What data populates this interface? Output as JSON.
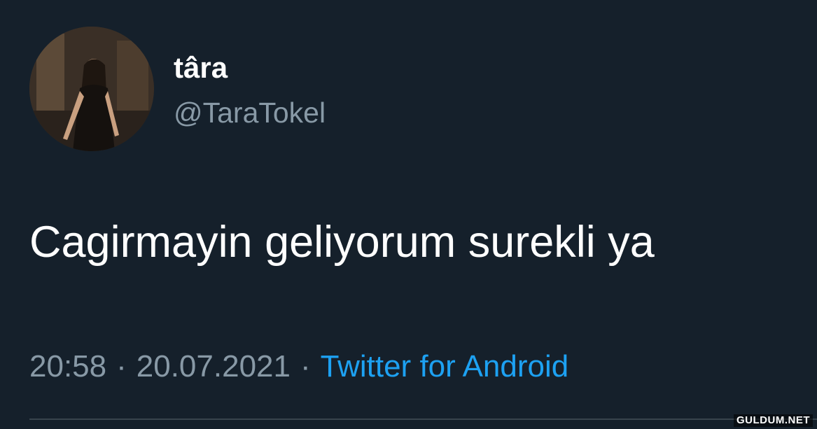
{
  "tweet": {
    "display_name": "târa",
    "handle": "@TaraTokel",
    "text": "Cagirmayin geliyorum surekli ya",
    "time": "20:58",
    "date": "20.07.2021",
    "separator": "·",
    "source": "Twitter for Android"
  },
  "watermark": "GULDUM.NET",
  "colors": {
    "background": "#15202b",
    "text_primary": "#ffffff",
    "text_secondary": "#8899a6",
    "accent": "#1da1f2",
    "divider": "#38444d"
  }
}
